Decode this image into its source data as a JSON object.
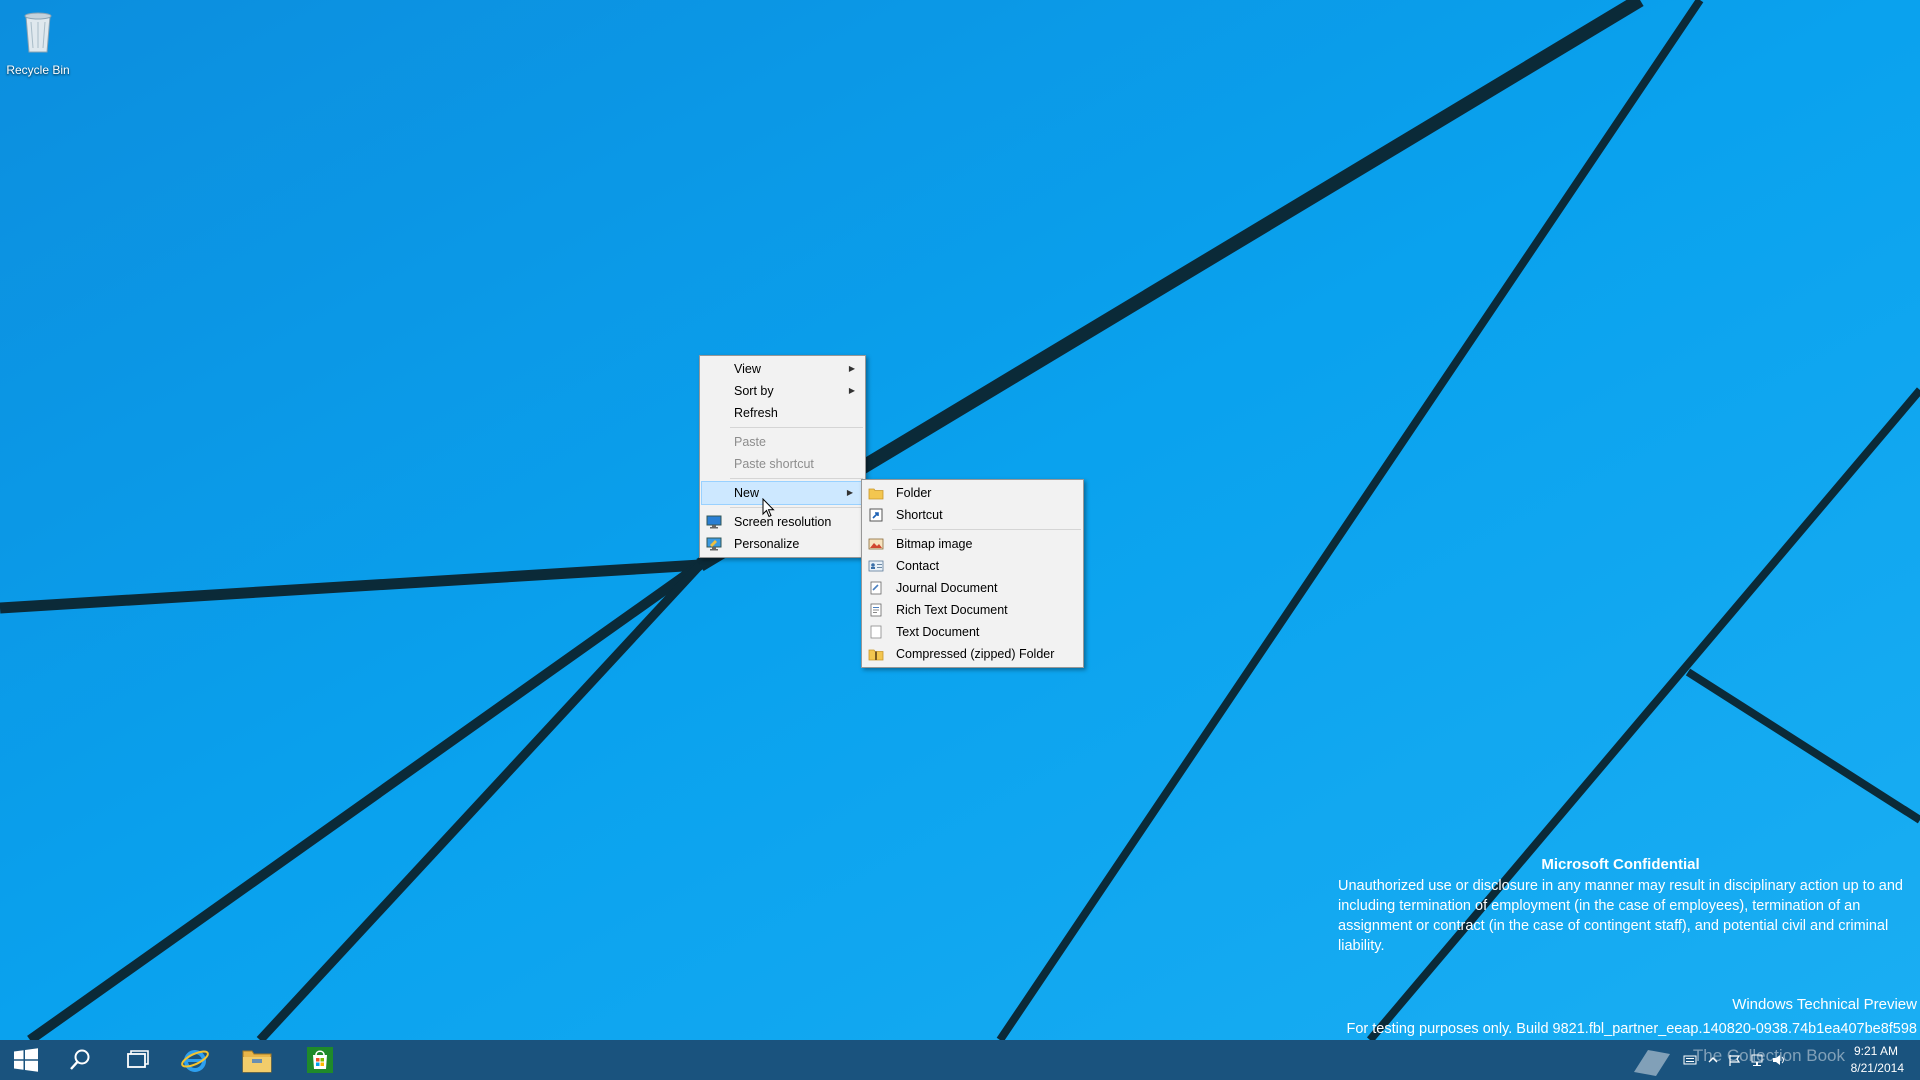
{
  "desktop": {
    "recycle_bin_label": "Recycle Bin"
  },
  "context_menu": {
    "items": [
      {
        "label": "View",
        "has_submenu": true
      },
      {
        "label": "Sort by",
        "has_submenu": true
      },
      {
        "label": "Refresh"
      },
      {
        "label": "Paste",
        "disabled": true
      },
      {
        "label": "Paste shortcut",
        "disabled": true
      },
      {
        "label": "New",
        "has_submenu": true,
        "highlighted": true
      },
      {
        "label": "Screen resolution",
        "icon": "screen-resolution-icon"
      },
      {
        "label": "Personalize",
        "icon": "personalize-icon"
      }
    ]
  },
  "new_submenu": {
    "items": [
      {
        "label": "Folder",
        "icon": "folder-icon"
      },
      {
        "label": "Shortcut",
        "icon": "shortcut-icon"
      },
      {
        "label": "Bitmap image",
        "icon": "bitmap-icon"
      },
      {
        "label": "Contact",
        "icon": "contact-icon"
      },
      {
        "label": "Journal Document",
        "icon": "journal-icon"
      },
      {
        "label": "Rich Text Document",
        "icon": "rich-text-icon"
      },
      {
        "label": "Text Document",
        "icon": "text-document-icon"
      },
      {
        "label": "Compressed (zipped) Folder",
        "icon": "zip-folder-icon"
      }
    ]
  },
  "watermark": {
    "title": "Microsoft Confidential",
    "body": "Unauthorized use or disclosure in any manner may result in disciplinary action up to and including termination of employment (in the case of employees), termination of an assignment or contract (in the case of contingent staff), and potential civil and criminal liability.",
    "edition": "Windows Technical Preview",
    "build": "For testing purposes only. Build 9821.fbl_partner_eeap.140820-0938.74b1ea407be8f598",
    "logo_text": "The Collection Book"
  },
  "taskbar": {
    "buttons": [
      "start-icon",
      "search-icon",
      "task-view-icon",
      "internet-explorer-icon",
      "file-explorer-icon",
      "store-icon"
    ],
    "clock_time": "9:21 AM",
    "clock_date": "8/21/2014"
  },
  "colors": {
    "wallpaper": "#0a97e8",
    "menu_highlight": "#cde8ff",
    "taskbar": "#1c4a6e"
  }
}
